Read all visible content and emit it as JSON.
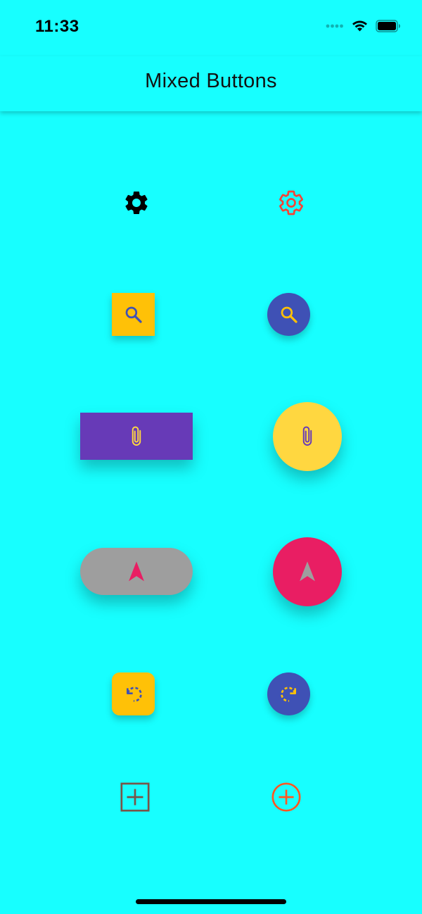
{
  "status_bar": {
    "time": "11:33"
  },
  "app_bar": {
    "title": "Mixed Buttons"
  },
  "colors": {
    "background": "#17FFFF",
    "amber": "#FFC107",
    "indigo": "#3F51B5",
    "deep_purple": "#673AB7",
    "yellow": "#FFD740",
    "grey": "#9E9E9E",
    "pink": "#E91E63",
    "red": "#F44336",
    "brown": "#795548",
    "deep_orange": "#FF5722"
  },
  "buttons": [
    {
      "row": 1,
      "side": "left",
      "type": "icon-button",
      "icon": "settings-icon",
      "icon_color": "#000000"
    },
    {
      "row": 1,
      "side": "right",
      "type": "icon-button",
      "icon": "settings-outline-icon",
      "icon_color": "#F44336"
    },
    {
      "row": 2,
      "side": "left",
      "type": "square-button",
      "icon": "search-icon",
      "background": "#FFC107",
      "icon_color": "#3F51B5"
    },
    {
      "row": 2,
      "side": "right",
      "type": "circle-button",
      "icon": "search-icon",
      "background": "#3F51B5",
      "icon_color": "#FFC107"
    },
    {
      "row": 3,
      "side": "left",
      "type": "wide-rect-button",
      "icon": "attach-icon",
      "background": "#673AB7",
      "icon_color": "#FFD740"
    },
    {
      "row": 3,
      "side": "right",
      "type": "large-circle-button",
      "icon": "attach-icon",
      "background": "#FFD740",
      "icon_color": "#673AB7"
    },
    {
      "row": 4,
      "side": "left",
      "type": "pill-button",
      "icon": "navigation-icon",
      "background": "#9E9E9E",
      "icon_color": "#E91E63"
    },
    {
      "row": 4,
      "side": "right",
      "type": "large-circle-button",
      "icon": "navigation-icon",
      "background": "#E91E63",
      "icon_color": "#9E9E9E"
    },
    {
      "row": 5,
      "side": "left",
      "type": "rounded-square-button",
      "icon": "rotate-left-icon",
      "background": "#FFC107",
      "icon_color": "#3F51B5"
    },
    {
      "row": 5,
      "side": "right",
      "type": "circle-button",
      "icon": "rotate-right-icon",
      "background": "#3F51B5",
      "icon_color": "#FFC107"
    },
    {
      "row": 6,
      "side": "left",
      "type": "icon-button",
      "icon": "add-box-outline-icon",
      "icon_color": "#795548"
    },
    {
      "row": 6,
      "side": "right",
      "type": "icon-button",
      "icon": "add-circle-outline-icon",
      "icon_color": "#FF5722"
    }
  ]
}
